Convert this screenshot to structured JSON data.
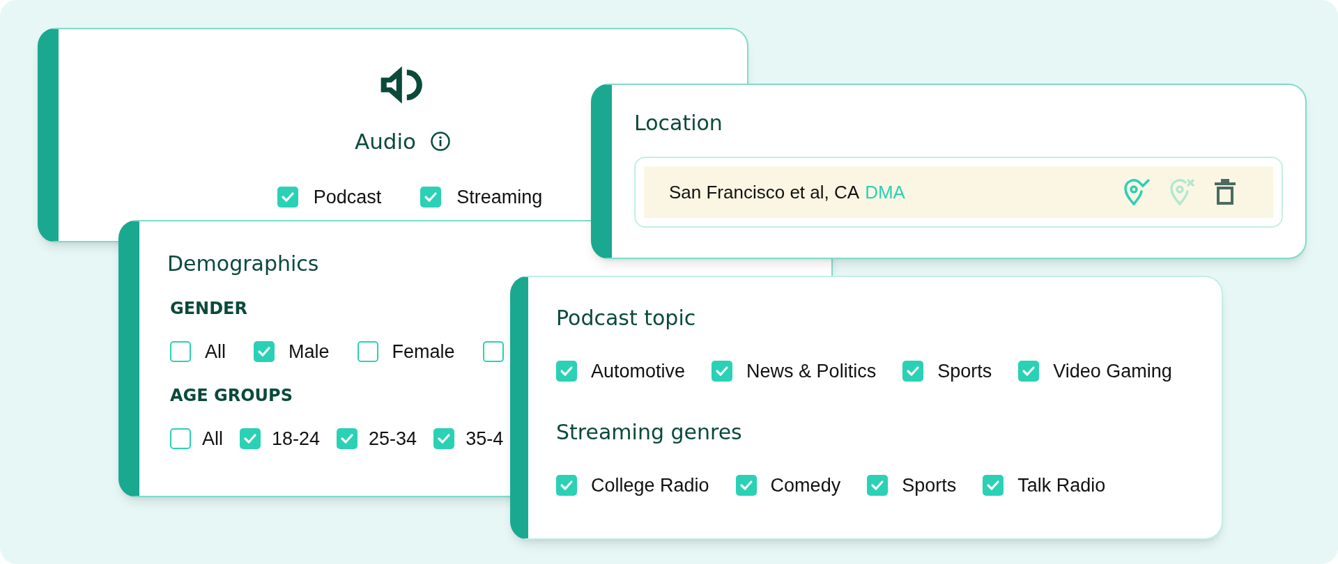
{
  "audio": {
    "title": "Audio",
    "options": [
      {
        "label": "Podcast",
        "checked": true
      },
      {
        "label": "Streaming",
        "checked": true
      }
    ]
  },
  "demographics": {
    "title": "Demographics",
    "groups": [
      {
        "heading": "GENDER",
        "options": [
          {
            "label": "All",
            "checked": false
          },
          {
            "label": "Male",
            "checked": true
          },
          {
            "label": "Female",
            "checked": false
          },
          {
            "checked": false
          }
        ]
      },
      {
        "heading": "AGE GROUPS",
        "options": [
          {
            "label": "All",
            "checked": false
          },
          {
            "label": "18-24",
            "checked": true
          },
          {
            "label": "25-34",
            "checked": true
          },
          {
            "label": "35-4",
            "checked": true
          }
        ]
      }
    ]
  },
  "location": {
    "title": "Location",
    "entry": {
      "name": "San Francisco et al, CA",
      "tag": "DMA"
    }
  },
  "topics": {
    "groups": [
      {
        "heading": "Podcast topic",
        "options": [
          {
            "label": "Automotive",
            "checked": true
          },
          {
            "label": "News & Politics",
            "checked": true
          },
          {
            "label": "Sports",
            "checked": true
          },
          {
            "label": "Video Gaming",
            "checked": true
          }
        ]
      },
      {
        "heading": "Streaming genres",
        "options": [
          {
            "label": "College Radio",
            "checked": true
          },
          {
            "label": "Comedy",
            "checked": true
          },
          {
            "label": "Sports",
            "checked": true
          },
          {
            "label": "Talk Radio",
            "checked": true
          }
        ]
      }
    ]
  }
}
